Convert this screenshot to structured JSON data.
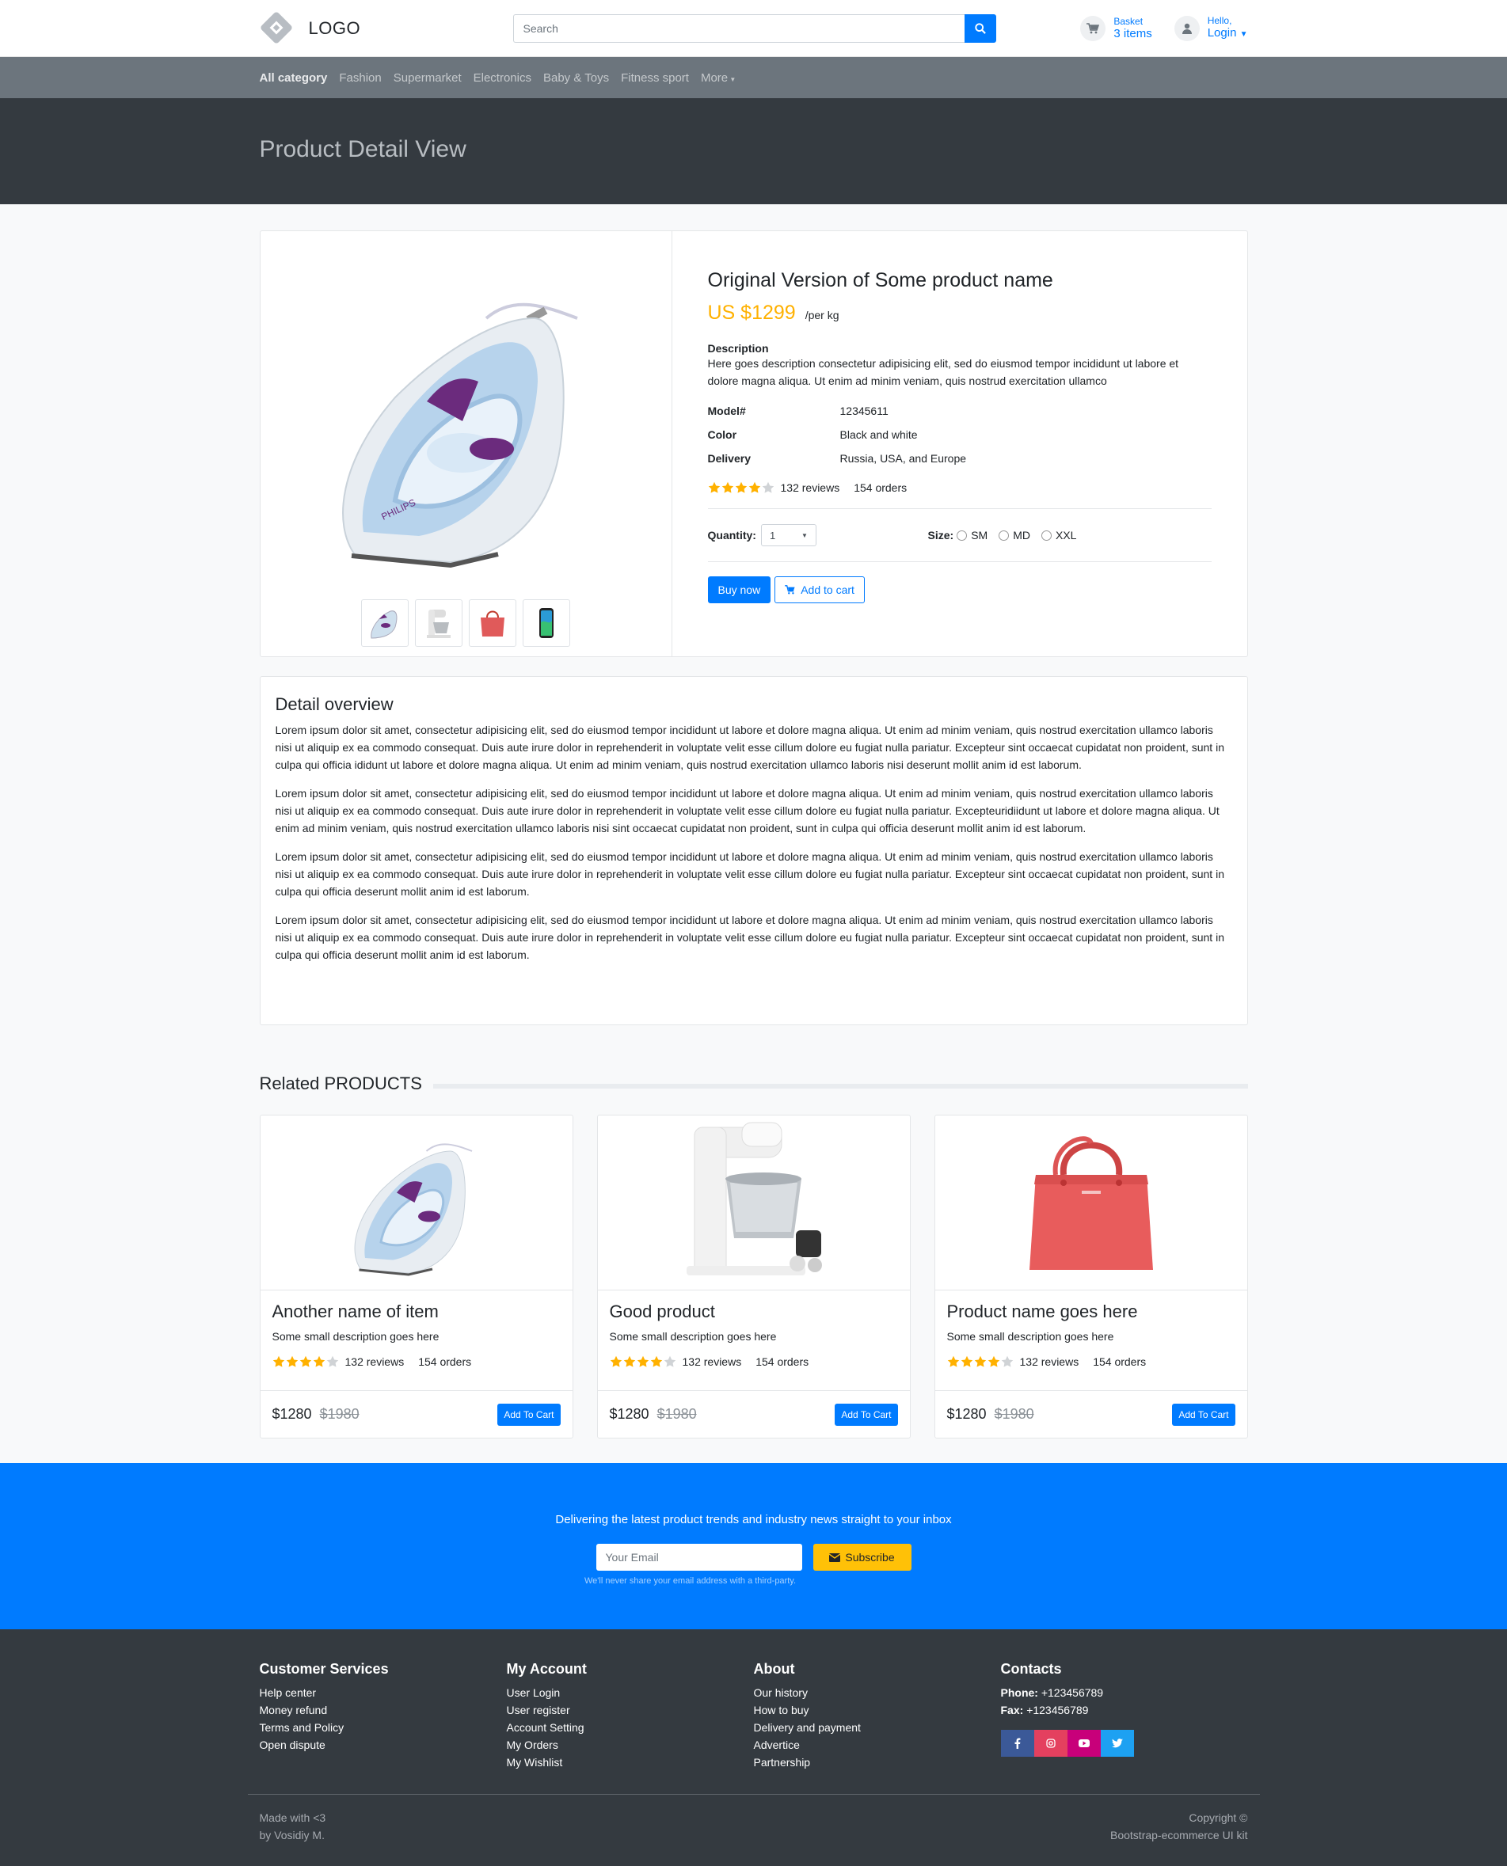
{
  "header": {
    "logo_text": "LOGO",
    "search_placeholder": "Search",
    "basket_label": "Basket",
    "basket_value": "3 items",
    "hello_label": "Hello,",
    "login_label": "Login"
  },
  "nav": {
    "items": [
      "All category",
      "Fashion",
      "Supermarket",
      "Electronics",
      "Baby & Toys",
      "Fitness sport",
      "More"
    ]
  },
  "page_title": "Product Detail View",
  "product": {
    "name": "Original Version of Some product name",
    "price": "US $1299",
    "unit": "/per kg",
    "description_title": "Description",
    "description": "Here goes description consectetur adipisicing elit, sed do eiusmod tempor incididunt ut labore et dolore magna aliqua. Ut enim ad minim veniam, quis nostrud exercitation ullamco",
    "specs": [
      {
        "label": "Model#",
        "value": "12345611"
      },
      {
        "label": "Color",
        "value": "Black and white"
      },
      {
        "label": "Delivery",
        "value": "Russia, USA, and Europe"
      }
    ],
    "rating": 4,
    "reviews": "132 reviews",
    "orders": "154 orders",
    "quantity_label": "Quantity:",
    "quantity_value": "1",
    "size_label": "Size:",
    "sizes": [
      "SM",
      "MD",
      "XXL"
    ],
    "buy_label": "Buy now",
    "cart_label": "Add to cart"
  },
  "overview": {
    "title": "Detail overview",
    "paragraphs": [
      "Lorem ipsum dolor sit amet, consectetur adipisicing elit, sed do eiusmod tempor incididunt ut labore et dolore magna aliqua. Ut enim ad minim veniam, quis nostrud exercitation ullamco laboris nisi ut aliquip ex ea commodo consequat. Duis aute irure dolor in reprehenderit in voluptate velit esse cillum dolore eu fugiat nulla pariatur. Excepteur sint occaecat cupidatat non proident, sunt in culpa qui officia ididunt ut labore et dolore magna aliqua. Ut enim ad minim veniam, quis nostrud exercitation ullamco laboris nisi deserunt mollit anim id est laborum.",
      "Lorem ipsum dolor sit amet, consectetur adipisicing elit, sed do eiusmod tempor incididunt ut labore et dolore magna aliqua. Ut enim ad minim veniam, quis nostrud exercitation ullamco laboris nisi ut aliquip ex ea commodo consequat. Duis aute irure dolor in reprehenderit in voluptate velit esse cillum dolore eu fugiat nulla pariatur. Excepteuridiidunt ut labore et dolore magna aliqua. Ut enim ad minim veniam, quis nostrud exercitation ullamco laboris nisi sint occaecat cupidatat non proident, sunt in culpa qui officia deserunt mollit anim id est laborum.",
      "Lorem ipsum dolor sit amet, consectetur adipisicing elit, sed do eiusmod tempor incididunt ut labore et dolore magna aliqua. Ut enim ad minim veniam, quis nostrud exercitation ullamco laboris nisi ut aliquip ex ea commodo consequat. Duis aute irure dolor in reprehenderit in voluptate velit esse cillum dolore eu fugiat nulla pariatur. Excepteur sint occaecat cupidatat non proident, sunt in culpa qui officia deserunt mollit anim id est laborum.",
      "Lorem ipsum dolor sit amet, consectetur adipisicing elit, sed do eiusmod tempor incididunt ut labore et dolore magna aliqua. Ut enim ad minim veniam, quis nostrud exercitation ullamco laboris nisi ut aliquip ex ea commodo consequat. Duis aute irure dolor in reprehenderit in voluptate velit esse cillum dolore eu fugiat nulla pariatur. Excepteur sint occaecat cupidatat non proident, sunt in culpa qui officia deserunt mollit anim id est laborum."
    ]
  },
  "related": {
    "title": "Related PRODUCTS",
    "items": [
      {
        "name": "Another name of item",
        "desc": "Some small description goes here",
        "reviews": "132 reviews",
        "orders": "154 orders",
        "price": "$1280",
        "old_price": "$1980",
        "button": "Add To Cart",
        "image": "iron",
        "rating": 4
      },
      {
        "name": "Good product",
        "desc": "Some small description goes here",
        "reviews": "132 reviews",
        "orders": "154 orders",
        "price": "$1280",
        "old_price": "$1980",
        "button": "Add To Cart",
        "image": "mixer",
        "rating": 4
      },
      {
        "name": "Product name goes here",
        "desc": "Some small description goes here",
        "reviews": "132 reviews",
        "orders": "154 orders",
        "price": "$1280",
        "old_price": "$1980",
        "button": "Add To Cart",
        "image": "bag",
        "rating": 4
      }
    ]
  },
  "subscribe": {
    "lead": "Delivering the latest product trends and industry news straight to your inbox",
    "placeholder": "Your Email",
    "button": "Subscribe",
    "note": "We'll never share your email address with a third-party."
  },
  "footer": {
    "customer": {
      "title": "Customer Services",
      "links": [
        "Help center",
        "Money refund",
        "Terms and Policy",
        "Open dispute"
      ]
    },
    "account": {
      "title": "My Account",
      "links": [
        "User Login",
        "User register",
        "Account Setting",
        "My Orders",
        "My Wishlist"
      ]
    },
    "about": {
      "title": "About",
      "links": [
        "Our history",
        "How to buy",
        "Delivery and payment",
        "Advertice",
        "Partnership"
      ]
    },
    "contacts": {
      "title": "Contacts",
      "phone_label": "Phone:",
      "phone": "+123456789",
      "fax_label": "Fax:",
      "fax": "+123456789"
    },
    "social_colors": [
      "#3b5998",
      "#e4405f",
      "#c8007a",
      "#1da1f2"
    ],
    "made_with_1": "Made with <3",
    "made_with_2": "by Vosidiy M.",
    "copyright_1": "Copyright ©",
    "copyright_2": "Bootstrap-ecommerce UI kit"
  },
  "colors": {
    "accent": "#007bff",
    "price": "#ffb100",
    "star": "#ffb100",
    "dark": "#343a40",
    "nav": "#6c757d"
  }
}
